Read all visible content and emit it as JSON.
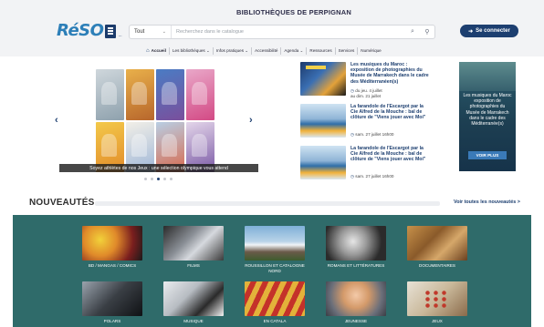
{
  "header": {
    "logo_text": "RéSO",
    "logo_sub": "...",
    "site_title": "BIBLIOTHÈQUES DE PERPIGNAN",
    "search": {
      "select_value": "Tout",
      "placeholder": "Recherchez dans le catalogue"
    },
    "login_label": "Se connecter"
  },
  "nav": {
    "items": [
      {
        "label": "Accueil"
      },
      {
        "label": "Les bibliothèques ⌄"
      },
      {
        "label": "Infos pratiques ⌄"
      },
      {
        "label": "Accessibilité"
      },
      {
        "label": "Agenda ⌄"
      },
      {
        "label": "Ressources"
      },
      {
        "label": "Services"
      },
      {
        "label": "Numérique"
      }
    ]
  },
  "slider": {
    "caption": "Soyez athlètes de nos Jeux : une sélection olympique vous attend"
  },
  "news": [
    {
      "title": "Les musiques du Maroc : exposition de photographies du Musée de Marrakech dans le cadre des Méditerranéen(s)",
      "meta_line1": "du jeu. 4 juillet",
      "meta_line2": "au dim. 21 juillet"
    },
    {
      "title": "La farandole de l'Escargot par la Cie Alfred de la Mouche : bal de clôture de \"Viens jouer avec Moi\"",
      "meta_line1": "sam. 27 juillet 16h00",
      "meta_line2": ""
    },
    {
      "title": "La farandole de l'Escargot par la Cie Alfred de la Mouche : bal de clôture de \"Viens jouer avec Moi\"",
      "meta_line1": "sam. 27 juillet 16h00",
      "meta_line2": ""
    }
  ],
  "promo": {
    "text": "Les musiques du Maroc exposition de photographies du Musée de Marrakech dans le cadre des Méditerranée(s)",
    "button": "VOIR PLUS"
  },
  "nouveautes": {
    "title": "NOUVEAUTÉS",
    "link": "Voir toutes les nouveautés >",
    "categories": [
      {
        "label": "BD / MANGAS / COMICS"
      },
      {
        "label": "FILMS"
      },
      {
        "label": "ROUSSILLON ET CATALOGNE NORD"
      },
      {
        "label": "ROMANS ET LITTÉRATURES"
      },
      {
        "label": "DOCUMENTAIRES"
      },
      {
        "label": "POLARS"
      },
      {
        "label": "MUSIQUE"
      },
      {
        "label": "EN CATALA"
      },
      {
        "label": "JEUNESSE"
      },
      {
        "label": "JEUX"
      }
    ]
  },
  "colors": {
    "brand_dark": "#1d3f70",
    "brand_logo": "#2d7fb8",
    "nouveautes_bg": "#2f6b6a",
    "header_bg": "#f2f3f5"
  }
}
